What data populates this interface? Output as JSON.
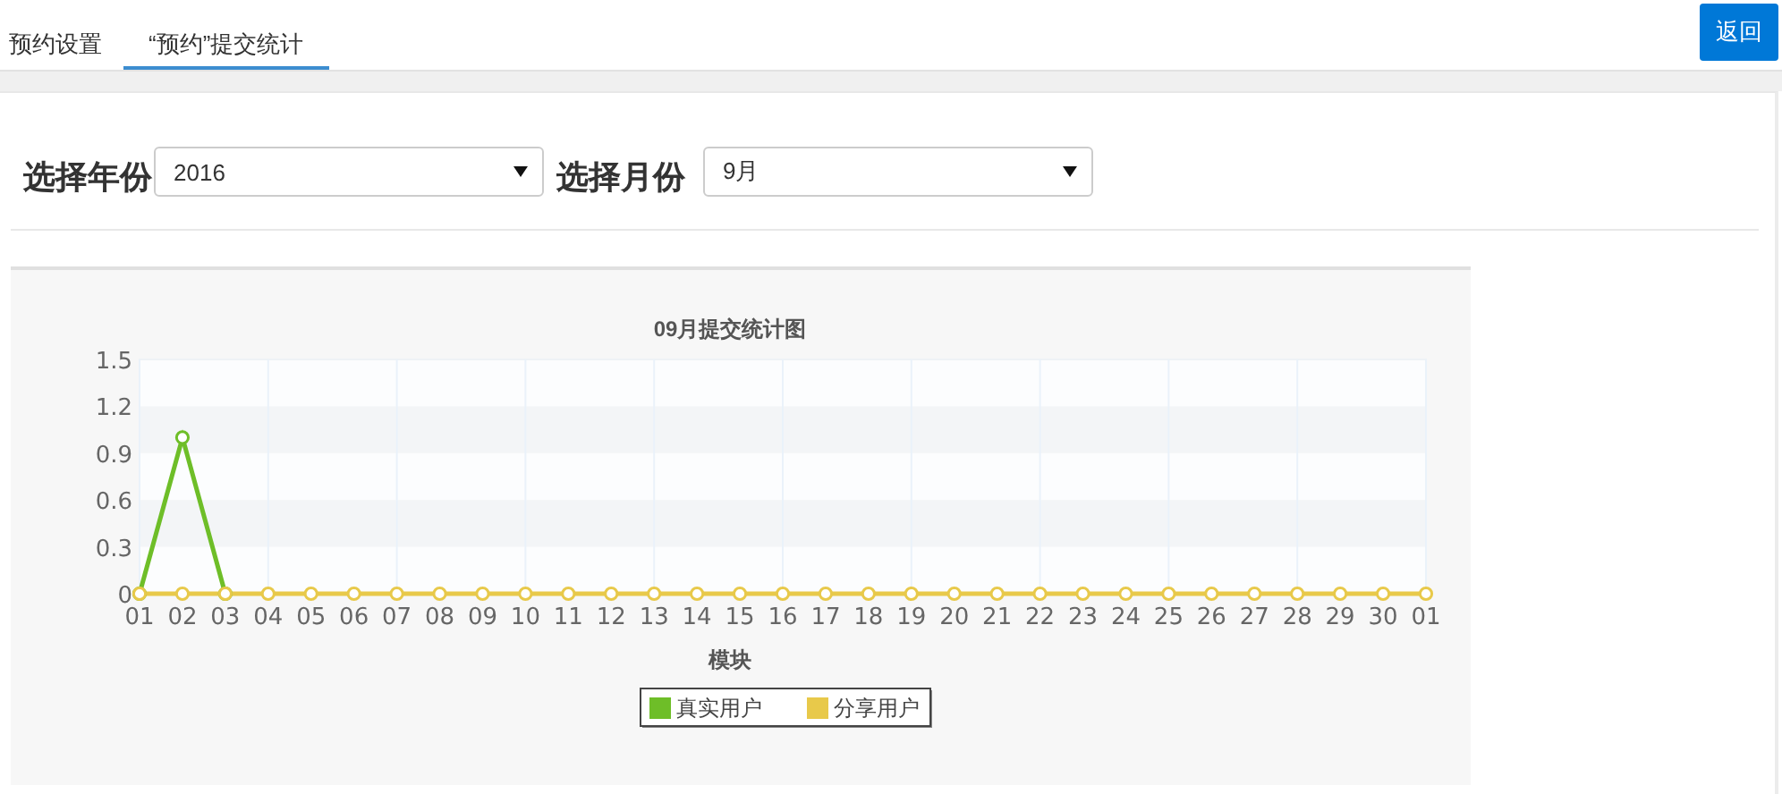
{
  "tabs": [
    {
      "label": "预约设置",
      "selected": false
    },
    {
      "label": "“预约”提交统计",
      "selected": true
    }
  ],
  "back_button": "返回",
  "filters": [
    {
      "label": "选择年份",
      "value": "2016"
    },
    {
      "label": "选择月份",
      "value": "9月"
    }
  ],
  "chart": {
    "chart_data": {
      "type": "line",
      "title": "09月提交统计图",
      "xlabel": "模块",
      "categories": [
        "01",
        "02",
        "03",
        "04",
        "05",
        "06",
        "07",
        "08",
        "09",
        "10",
        "11",
        "12",
        "13",
        "14",
        "15",
        "16",
        "17",
        "18",
        "19",
        "20",
        "21",
        "22",
        "23",
        "24",
        "25",
        "26",
        "27",
        "28",
        "29",
        "30",
        "01"
      ],
      "series": [
        {
          "name": "真实用户",
          "color": "#6ebe28",
          "marker": "circle",
          "values": [
            0,
            1,
            0,
            null,
            null,
            null,
            null,
            null,
            null,
            null,
            null,
            null,
            null,
            null,
            null,
            null,
            null,
            null,
            null,
            null,
            null,
            null,
            null,
            null,
            null,
            null,
            null,
            null,
            null,
            null,
            null
          ]
        },
        {
          "name": "分享用户",
          "color": "#e8c94a",
          "marker": "circle",
          "values": [
            0,
            0,
            0,
            0,
            0,
            0,
            0,
            0,
            0,
            0,
            0,
            0,
            0,
            0,
            0,
            0,
            0,
            0,
            0,
            0,
            0,
            0,
            0,
            0,
            0,
            0,
            0,
            0,
            0,
            0,
            0
          ]
        }
      ],
      "grid": true,
      "legend": "bottom",
      "ylim": [
        0,
        1.5
      ],
      "yticks": [
        0,
        {
          "value": 0.3,
          "label": "0.3"
        },
        {
          "value": 0.6,
          "label": "0.6"
        },
        {
          "value": 0.9,
          "label": "0.9"
        },
        {
          "value": 1.2,
          "label": "1.2"
        },
        {
          "value": 1.5,
          "label": "1.5"
        }
      ]
    }
  }
}
